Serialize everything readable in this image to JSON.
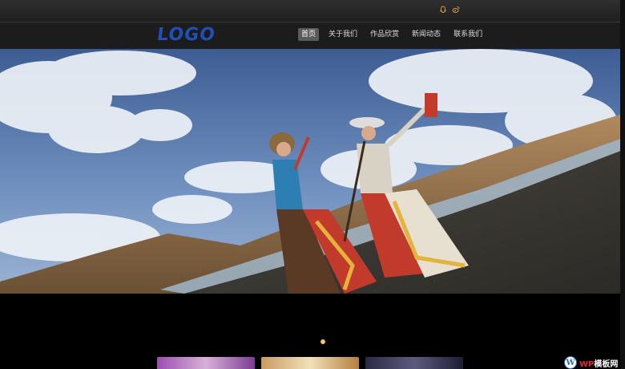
{
  "header": {
    "logo_text": "LOGO",
    "top_icons": [
      "qq-icon",
      "weibo-icon"
    ]
  },
  "nav": {
    "items": [
      {
        "label": "首页",
        "active": true
      },
      {
        "label": "关于我们",
        "active": false
      },
      {
        "label": "作品欣赏",
        "active": false
      },
      {
        "label": "新闻动态",
        "active": false
      },
      {
        "label": "联系我们",
        "active": false
      }
    ]
  },
  "slider": {
    "dot_count": 1,
    "active_index": 0,
    "dot_color": "#f3c463"
  },
  "footer_badge": {
    "prefix": "WP",
    "suffix": "模板网"
  },
  "colors": {
    "logo": "#1f4fb8",
    "nav_active_bg": "#5b5b5b"
  }
}
